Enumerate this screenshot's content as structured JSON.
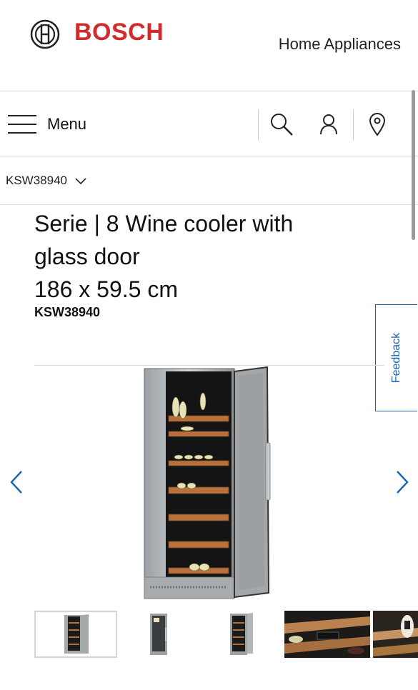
{
  "header": {
    "brand": "BOSCH",
    "section": "Home Appliances",
    "logo_icon": "bosch-armature-icon"
  },
  "nav": {
    "menu_label": "Menu",
    "icons": [
      "search-icon",
      "user-icon",
      "location-pin-icon"
    ]
  },
  "breadcrumb": {
    "label": "KSW38940",
    "icon": "chevron-down-icon"
  },
  "product": {
    "title": "Serie | 8 Wine cooler with glass door",
    "dimensions": "186 x 59.5 cm",
    "sku": "KSW38940"
  },
  "feedback": {
    "label": "Feedback"
  },
  "gallery": {
    "thumbnail_count": 5,
    "selected_index": 0
  },
  "colors": {
    "brand_red": "#d12b2b",
    "link_blue": "#1a64b4",
    "divider": "#dcdcdc"
  }
}
